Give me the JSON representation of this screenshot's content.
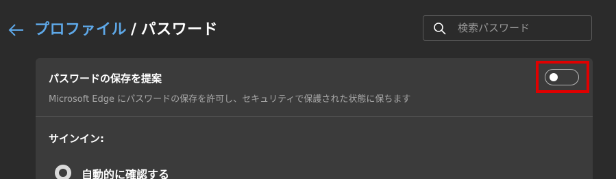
{
  "header": {
    "breadcrumb_parent": "プロファイル",
    "breadcrumb_separator": "/",
    "breadcrumb_current": "パスワード"
  },
  "search": {
    "placeholder": "検索パスワード",
    "value": ""
  },
  "offer_to_save": {
    "title": "パスワードの保存を提案",
    "description": "Microsoft Edge にパスワードの保存を許可し、セキュリティで保護された状態に保ちます",
    "toggle_state": "off"
  },
  "sign_in": {
    "label": "サインイン:",
    "options": [
      {
        "label": "自動的に確認する",
        "selected": true
      }
    ]
  },
  "colors": {
    "background": "#2b2b2b",
    "card": "#3b3b3b",
    "link_accent": "#5ea8e8",
    "highlight": "#e00000"
  },
  "icons": {
    "back": "arrow-left-icon",
    "search": "search-icon"
  }
}
